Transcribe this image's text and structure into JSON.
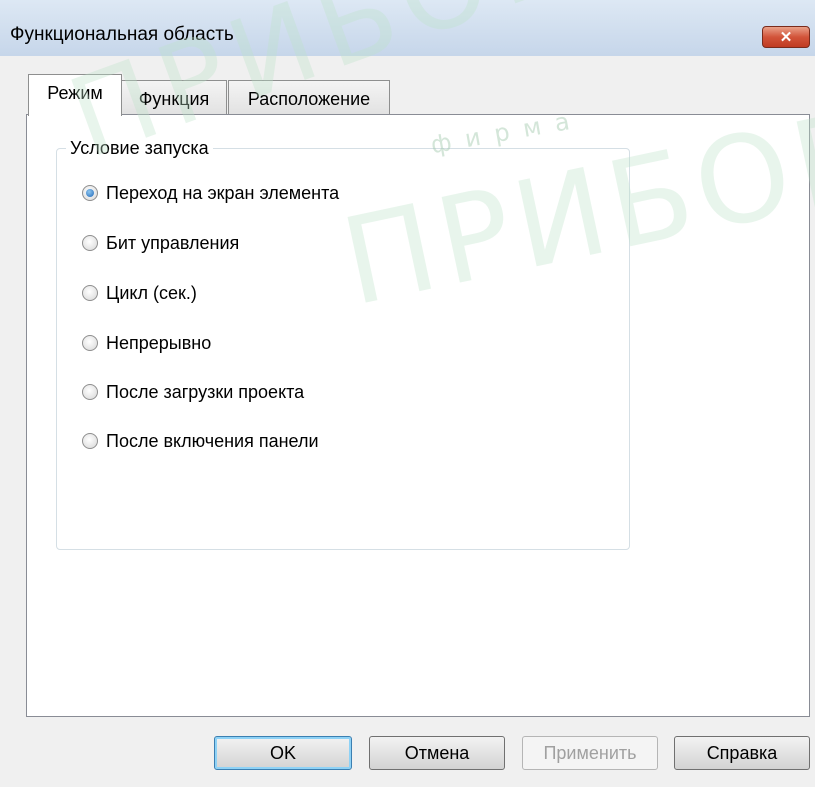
{
  "window": {
    "title": "Функциональная область",
    "close_icon": "close-icon"
  },
  "tabs": [
    {
      "label": "Режим",
      "active": true
    },
    {
      "label": "Функция",
      "active": false
    },
    {
      "label": "Расположение",
      "active": false
    }
  ],
  "start_condition": {
    "legend": "Условие запуска",
    "options": [
      {
        "label": "Переход на экран элемента",
        "checked": true
      },
      {
        "label": "Бит управления",
        "checked": false
      },
      {
        "label": "Цикл (сек.)",
        "checked": false
      },
      {
        "label": "Непрерывно",
        "checked": false
      },
      {
        "label": "После загрузки проекта",
        "checked": false
      },
      {
        "label": "После включения панели",
        "checked": false
      }
    ]
  },
  "buttons": {
    "ok": "OK",
    "cancel": "Отмена",
    "apply": "Применить",
    "help": "Справка"
  },
  "watermark": {
    "text_top": "ПРИБОР",
    "text_small": "фирма",
    "text_main": "ПРИБОР"
  },
  "colors": {
    "accent": "#3c7fb1",
    "close_button": "#c9472d",
    "titlebar": "#cfdbe9"
  }
}
